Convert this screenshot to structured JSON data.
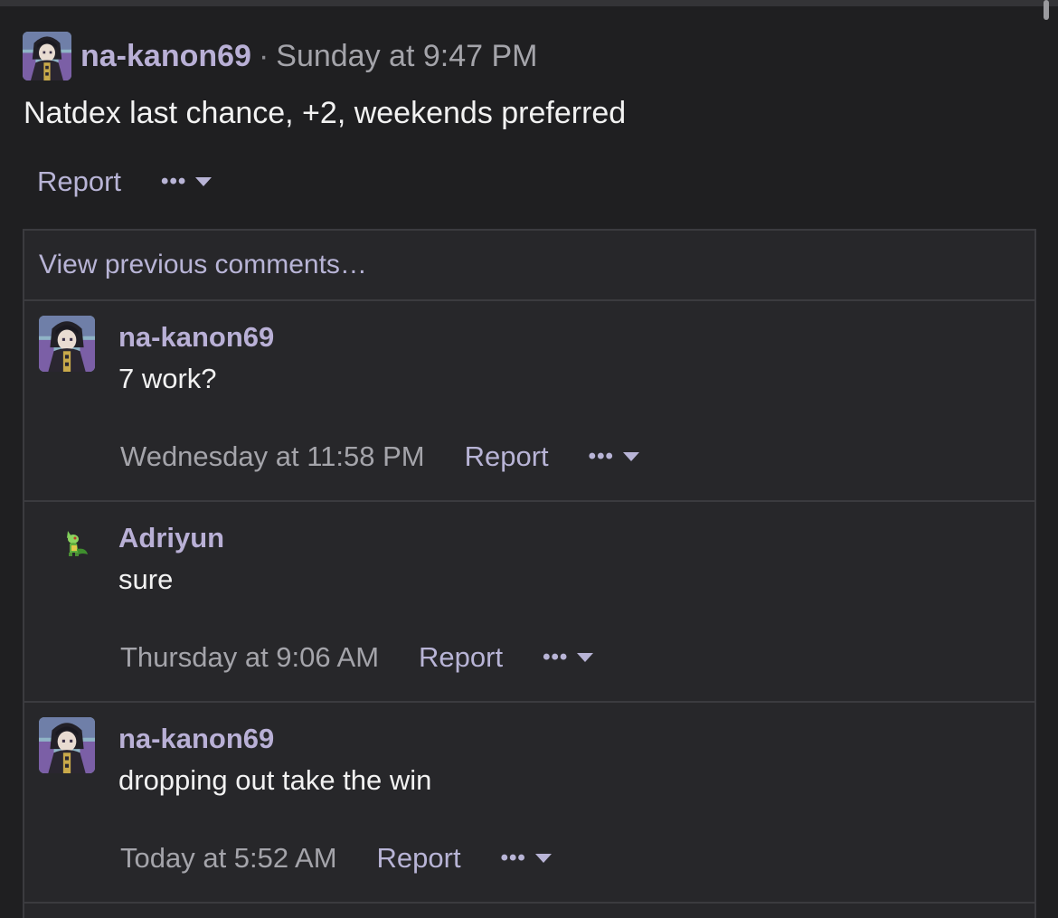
{
  "post": {
    "username": "na-kanon69",
    "separator": "·",
    "timestamp": "Sunday at 9:47 PM",
    "body": "Natdex last chance, +2, weekends preferred",
    "report_label": "Report",
    "more_label": "•••"
  },
  "comments_section": {
    "view_previous_label": "View previous comments…",
    "comments": [
      {
        "username": "na-kanon69",
        "text": "7 work?",
        "timestamp": "Wednesday at 11:58 PM",
        "report_label": "Report",
        "more_label": "•••",
        "avatar": "anime-character-avatar"
      },
      {
        "username": "Adriyun",
        "text": "sure",
        "timestamp": "Thursday at 9:06 AM",
        "report_label": "Report",
        "more_label": "•••",
        "avatar": "green-pokemon-sprite-avatar"
      },
      {
        "username": "na-kanon69",
        "text": "dropping out take the win",
        "timestamp": "Today at 5:52 AM",
        "report_label": "Report",
        "more_label": "•••",
        "avatar": "anime-character-avatar"
      }
    ]
  },
  "colors": {
    "background": "#1f1f21",
    "comment_background": "#27272a",
    "username": "#b9b0d6",
    "link": "#b8b4d6",
    "muted": "#a4a4aa"
  }
}
